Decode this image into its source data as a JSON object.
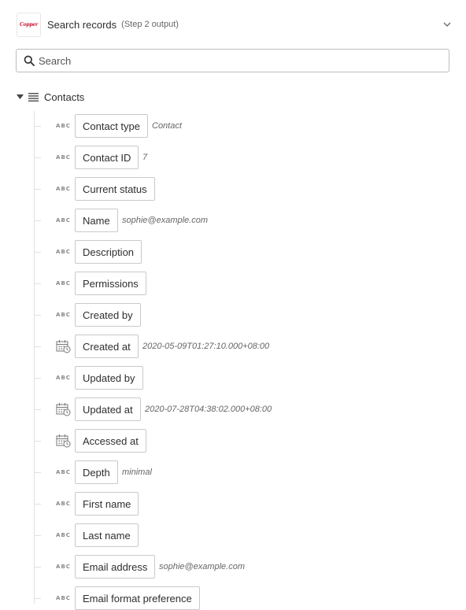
{
  "header": {
    "title": "Search records",
    "subtitle": "(Step 2 output)",
    "logo_text": "Copper",
    "chevron_icon": "chevron-down-icon"
  },
  "search": {
    "placeholder": "Search",
    "value": ""
  },
  "group": {
    "label": "Contacts",
    "expanded": true,
    "icon": "list-icon"
  },
  "fields": [
    {
      "label": "Contact type",
      "type": "text",
      "value": "Contact"
    },
    {
      "label": "Contact ID",
      "type": "text",
      "value": "7"
    },
    {
      "label": "Current status",
      "type": "text",
      "value": ""
    },
    {
      "label": "Name",
      "type": "text",
      "value": "sophie@example.com"
    },
    {
      "label": "Description",
      "type": "text",
      "value": ""
    },
    {
      "label": "Permissions",
      "type": "text",
      "value": ""
    },
    {
      "label": "Created by",
      "type": "text",
      "value": ""
    },
    {
      "label": "Created at",
      "type": "datetime",
      "value": "2020-05-09T01:27:10.000+08:00"
    },
    {
      "label": "Updated by",
      "type": "text",
      "value": ""
    },
    {
      "label": "Updated at",
      "type": "datetime",
      "value": "2020-07-28T04:38:02.000+08:00"
    },
    {
      "label": "Accessed at",
      "type": "datetime",
      "value": ""
    },
    {
      "label": "Depth",
      "type": "text",
      "value": "minimal"
    },
    {
      "label": "First name",
      "type": "text",
      "value": ""
    },
    {
      "label": "Last name",
      "type": "text",
      "value": ""
    },
    {
      "label": "Email address",
      "type": "text",
      "value": "sophie@example.com"
    },
    {
      "label": "Email format preference",
      "type": "text",
      "value": ""
    }
  ],
  "type_badge_text": "ABC",
  "colors": {
    "border": "#c9c9c9",
    "tree_line": "#e0e0e0",
    "logo": "#c8102e"
  }
}
